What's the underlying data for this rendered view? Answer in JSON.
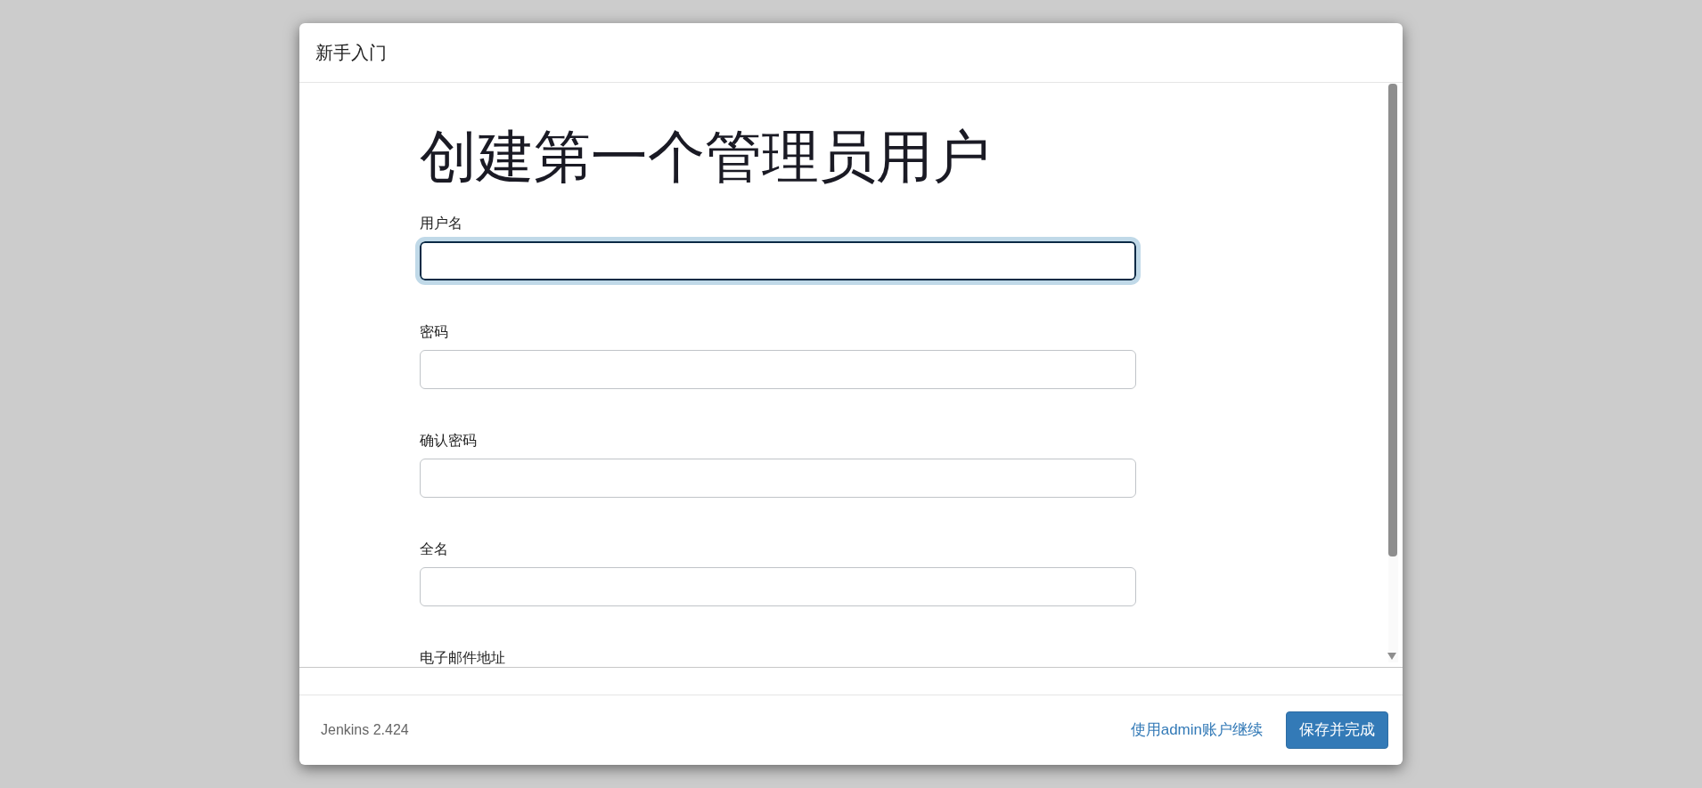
{
  "dialog": {
    "title": "新手入门"
  },
  "heading": "创建第一个管理员用户",
  "fields": [
    {
      "label": "用户名",
      "focused": true
    },
    {
      "label": "密码",
      "focused": false
    },
    {
      "label": "确认密码",
      "focused": false
    },
    {
      "label": "全名",
      "focused": false
    },
    {
      "label": "电子邮件地址"
    }
  ],
  "footer": {
    "version": "Jenkins 2.424",
    "link": "使用admin账户继续",
    "button": "保存并完成"
  }
}
